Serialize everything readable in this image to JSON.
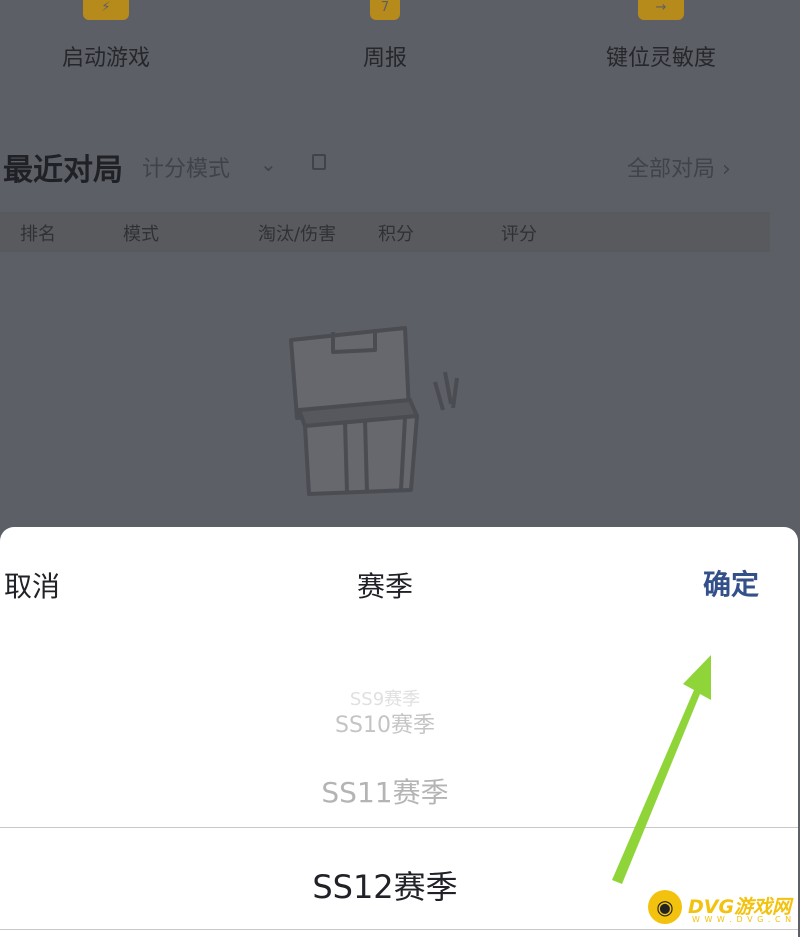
{
  "background": {
    "shortcuts": [
      {
        "label": "启动游戏",
        "icon": "launch-game-icon",
        "glyph": "⚡"
      },
      {
        "label": "周报",
        "icon": "weekly-report-icon",
        "glyph": "7"
      },
      {
        "label": "键位灵敏度",
        "icon": "key-sensitivity-icon",
        "glyph": "→"
      }
    ],
    "recent": {
      "title": "最近对局",
      "mode": "计分模式",
      "all_link": "全部对局 ›"
    },
    "table_headers": [
      "排名",
      "模式",
      "淘汰/伤害",
      "积分",
      "评分"
    ]
  },
  "sheet": {
    "cancel": "取消",
    "title": "赛季",
    "confirm": "确定",
    "options": [
      "SS9赛季",
      "SS10赛季",
      "SS11赛季",
      "SS12赛季"
    ],
    "selected_index": 3
  },
  "watermark": {
    "text": "DVG游戏网",
    "sub": "W W W . D V G . C N"
  },
  "colors": {
    "accent": "#34508a",
    "arrow": "#8fd53a",
    "overlay": "#5d5f66",
    "shortcut_icon": "#b68a1b"
  }
}
